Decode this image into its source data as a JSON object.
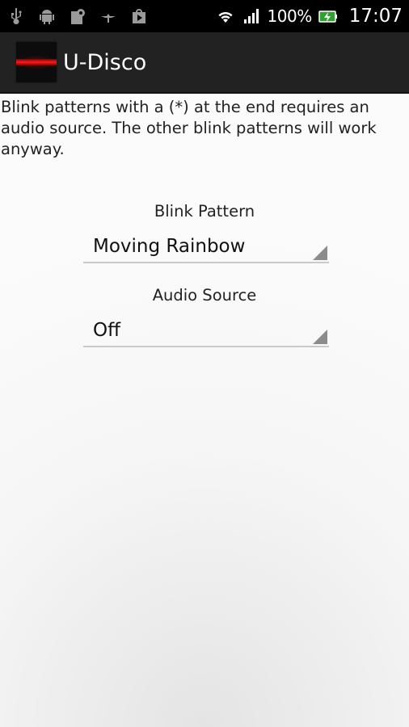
{
  "status_bar": {
    "icons_left": [
      "usb-icon",
      "android-debug-icon",
      "media-icon",
      "satellite-icon",
      "play-store-icon"
    ],
    "icons_right": [
      "wifi-icon",
      "signal-icon"
    ],
    "battery_percent": "100%",
    "battery_icon": "battery-charging-icon",
    "time": "17:07"
  },
  "action_bar": {
    "title": "U-Disco",
    "icon": "app-icon"
  },
  "main": {
    "info_text": "Blink patterns with a (*) at the end requires an audio source. The other blink patterns will work anyway.",
    "blink_pattern": {
      "label": "Blink Pattern",
      "selected": "Moving Rainbow"
    },
    "audio_source": {
      "label": "Audio Source",
      "selected": "Off"
    }
  },
  "colors": {
    "status_bar_bg": "#000000",
    "action_bar_bg": "#222222",
    "background": "#f6f6f6",
    "spinner_underline": "#c9c9c9"
  }
}
